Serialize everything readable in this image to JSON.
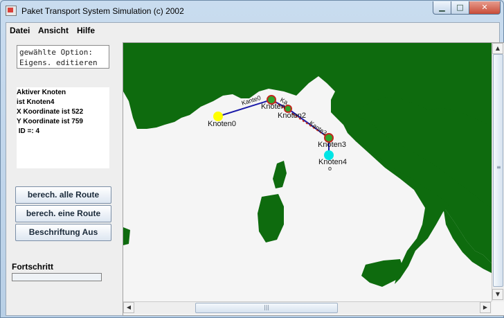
{
  "window": {
    "title": "Paket Transport System Simulation (c) 2002",
    "controls": {
      "minimize": "▁",
      "maximize": "□",
      "close": "✕"
    }
  },
  "menu": [
    "Datei",
    "Ansicht",
    "Hilfe"
  ],
  "option_box": {
    "line1": "gewählte Option:",
    "line2": "Eigens. editieren"
  },
  "info": {
    "line1": "Aktiver Knoten",
    "line2": "ist Knoten4",
    "line3": "X Koordinate ist 522",
    "line4": "Y Koordinate ist 759",
    "line5": " ID =: 4"
  },
  "buttons": {
    "calc_all": "berech. alle Route",
    "calc_one": "berech. eine Route",
    "labels_off": "Beschriftung Aus"
  },
  "progress": {
    "label": "Fortschritt",
    "value": 0
  },
  "map": {
    "land_color": "#0e6b0e",
    "sea_color": "#f5f5f5",
    "nodes": [
      {
        "id": "Knoten0",
        "color": "#ffff00"
      },
      {
        "id": "Knoten1",
        "color": "#2ea82e"
      },
      {
        "id": "Knoten2",
        "color": "#2ea82e"
      },
      {
        "id": "Knoten3",
        "color": "#2ea82e"
      },
      {
        "id": "Knoten4",
        "color": "#00e5e5"
      }
    ],
    "labels": {
      "k0": "Knoten0",
      "k1": "Knoten",
      "k2": "Knoten2",
      "k3": "Knoten3",
      "k4": "Knoten4",
      "k4_sub": "o",
      "edge1": "Kante0",
      "edge2": "Ka...",
      "edge3": "Kante3"
    }
  }
}
